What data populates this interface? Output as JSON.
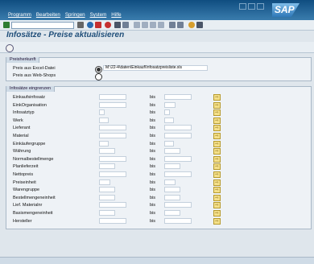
{
  "menu": {
    "items": [
      "Programm",
      "Bearbeiten",
      "Springen",
      "System",
      "Hilfe"
    ]
  },
  "logo": "SAP",
  "toolbar": {
    "icons": [
      "check-icon",
      "save-icon",
      "back-icon",
      "exit-icon",
      "cancel-icon",
      "print-icon",
      "find-icon",
      "first-page-icon",
      "prev-page-icon",
      "next-page-icon",
      "last-page-icon",
      "new-session-icon",
      "shortcut-icon",
      "help-icon",
      "customize-icon"
    ]
  },
  "page": {
    "title": "Infosätze - Preise aktualisieren"
  },
  "herkunft": {
    "title": "Preisherkunft",
    "excel_label": "Preis aus Excel-Datei",
    "excel_value": "M:\\22-4\\daten\\Einkauf\\Infosatzpreisliste.xls",
    "web_label": "Preis aus Web-Shops"
  },
  "eingrenzen": {
    "title": "Infosätze eingrenzen",
    "bis": "bis",
    "fields": [
      "Einkaufsinfosatz",
      "EinkOrganisation",
      "Infosatztyp",
      "Werk",
      "Lieferant",
      "Material",
      "Einkäufergruppe",
      "Währung",
      "Normalbestellmenge",
      "Planlieferzeit",
      "Nettopreis",
      "Preiseinheit",
      "Warengruppe",
      "Bestellmengeneinheit",
      "Lief. Materialnr",
      "Basismengeneinheit",
      "Hersteller"
    ]
  }
}
